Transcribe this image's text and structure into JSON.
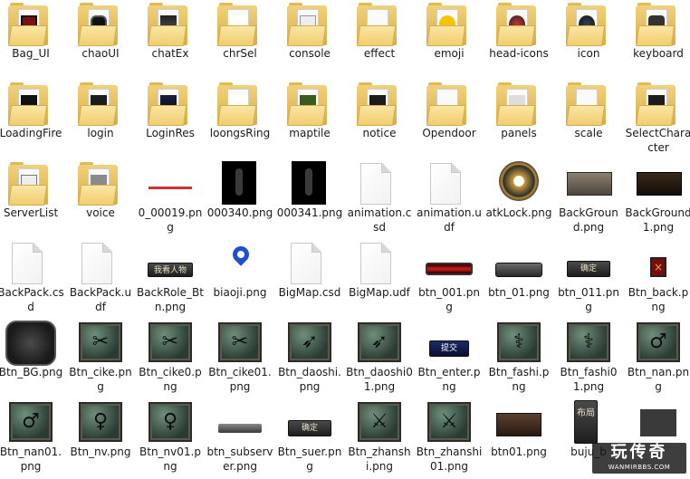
{
  "items": [
    {
      "label": "Bag_UI",
      "kind": "folder",
      "art": "bag-icon"
    },
    {
      "label": "chaoUI",
      "kind": "folder",
      "art": "black-frame-icon"
    },
    {
      "label": "chatEx",
      "kind": "folder",
      "art": "chat-icon"
    },
    {
      "label": "chrSel",
      "kind": "folder",
      "art": "blank-doc-icon"
    },
    {
      "label": "console",
      "kind": "folder",
      "art": "console-icon"
    },
    {
      "label": "effect",
      "kind": "folder",
      "art": "plain-folder-icon"
    },
    {
      "label": "emoji",
      "kind": "folder",
      "art": "emoji-icon"
    },
    {
      "label": "head-icons",
      "kind": "folder",
      "art": "head-icon"
    },
    {
      "label": "icon",
      "kind": "folder",
      "art": "icon-icon"
    },
    {
      "label": "keyboard",
      "kind": "folder",
      "art": "keyboard-icon"
    },
    {
      "label": "LoadingFire",
      "kind": "folder",
      "art": "fire-icon"
    },
    {
      "label": "login",
      "kind": "folder",
      "art": "dark-doc-icon"
    },
    {
      "label": "LoginRes",
      "kind": "folder",
      "art": "night-scene-icon"
    },
    {
      "label": "loongsRing",
      "kind": "folder",
      "art": "ring-icon"
    },
    {
      "label": "maptile",
      "kind": "folder",
      "art": "map-tile-icon"
    },
    {
      "label": "notice",
      "kind": "folder",
      "art": "dark-doc-icon"
    },
    {
      "label": "Opendoor",
      "kind": "folder",
      "art": "plain-folder-icon"
    },
    {
      "label": "panels",
      "kind": "folder",
      "art": "panels-icon"
    },
    {
      "label": "scale",
      "kind": "folder",
      "art": "plain-folder-icon"
    },
    {
      "label": "SelectCharacter",
      "kind": "folder",
      "art": "dark-doc-icon"
    },
    {
      "label": "ServerList",
      "kind": "folder",
      "art": "server-icon"
    },
    {
      "label": "voice",
      "kind": "folder",
      "art": "grey-doc-icon"
    },
    {
      "label": "0_00019.png",
      "kind": "image",
      "art": "red-line"
    },
    {
      "label": "000340.png",
      "kind": "image",
      "art": "dark-figure"
    },
    {
      "label": "000341.png",
      "kind": "image",
      "art": "dark-figure"
    },
    {
      "label": "animation.csd",
      "kind": "file",
      "art": "file-icon"
    },
    {
      "label": "animation.udf",
      "kind": "file",
      "art": "file-icon"
    },
    {
      "label": "atkLock.png",
      "kind": "image",
      "art": "lock-target"
    },
    {
      "label": "BackGround.png",
      "kind": "image",
      "art": "stone-wall"
    },
    {
      "label": "BackGround1.png",
      "kind": "image",
      "art": "dark-wall"
    },
    {
      "label": "BackPack.csd",
      "kind": "file",
      "art": "file-icon"
    },
    {
      "label": "BackPack.udf",
      "kind": "file",
      "art": "file-icon"
    },
    {
      "label": "BackRole_Btn.png",
      "kind": "image",
      "art": "role-plate"
    },
    {
      "label": "biaoji.png",
      "kind": "image",
      "art": "map-pin"
    },
    {
      "label": "BigMap.csd",
      "kind": "file",
      "art": "file-icon"
    },
    {
      "label": "BigMap.udf",
      "kind": "file",
      "art": "file-icon"
    },
    {
      "label": "btn_001.png",
      "kind": "image",
      "art": "red-bar"
    },
    {
      "label": "btn_01.png",
      "kind": "image",
      "art": "grey-bar"
    },
    {
      "label": "btn_011.png",
      "kind": "image",
      "art": "confirm-plate"
    },
    {
      "label": "Btn_back.png",
      "kind": "image",
      "art": "back-x"
    },
    {
      "label": "Btn_BG.png",
      "kind": "image",
      "art": "round-stone"
    },
    {
      "label": "Btn_cike.png",
      "kind": "image",
      "art": "stone-blades"
    },
    {
      "label": "Btn_cike0.png",
      "kind": "image",
      "art": "stone-blades"
    },
    {
      "label": "Btn_cike01.png",
      "kind": "image",
      "art": "stone-blades"
    },
    {
      "label": "Btn_daoshi.png",
      "kind": "image",
      "art": "stone-runner"
    },
    {
      "label": "Btn_daoshi01.png",
      "kind": "image",
      "art": "stone-runner"
    },
    {
      "label": "Btn_enter.png",
      "kind": "image",
      "art": "enter-plate"
    },
    {
      "label": "Btn_fashi.png",
      "kind": "image",
      "art": "stone-staff"
    },
    {
      "label": "Btn_fashi01.png",
      "kind": "image",
      "art": "stone-staff"
    },
    {
      "label": "Btn_nan.png",
      "kind": "image",
      "art": "stone-male"
    },
    {
      "label": "Btn_nan01.png",
      "kind": "image",
      "art": "stone-male"
    },
    {
      "label": "Btn_nv.png",
      "kind": "image",
      "art": "stone-female"
    },
    {
      "label": "Btn_nv01.png",
      "kind": "image",
      "art": "stone-female"
    },
    {
      "label": "btn_subserver.png",
      "kind": "image",
      "art": "grey-strip"
    },
    {
      "label": "Btn_suer.png",
      "kind": "image",
      "art": "confirm-plate"
    },
    {
      "label": "Btn_zhanshi.png",
      "kind": "image",
      "art": "stone-sword"
    },
    {
      "label": "Btn_zhanshi01.png",
      "kind": "image",
      "art": "stone-sword"
    },
    {
      "label": "btn01.png",
      "kind": "image",
      "art": "brown-bar"
    },
    {
      "label": "buju_b",
      "kind": "image",
      "art": "vertical-plate"
    },
    {
      "label": "",
      "kind": "image",
      "art": "partial-plate"
    }
  ],
  "texts": {
    "back_role_btn_text": "我看人物",
    "confirm_text": "确定",
    "enter_text": "提交",
    "layout_text": "布局"
  },
  "watermark": {
    "main": "玩传奇",
    "sub": "WANMIRBBS.COM"
  }
}
